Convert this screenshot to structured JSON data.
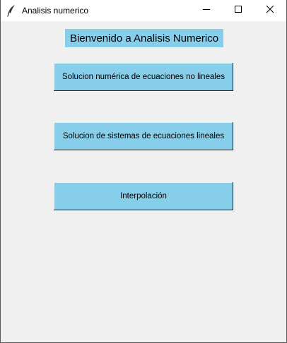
{
  "window": {
    "title": "Analisis numerico",
    "icon": "feather-icon"
  },
  "main": {
    "welcome_label": "Bienvenido a Analisis Numerico",
    "buttons": [
      {
        "label": "Solucion numérica de ecuaciones no lineales"
      },
      {
        "label": "Solucion de sistemas de ecuaciones lineales"
      },
      {
        "label": "Interpolación"
      }
    ]
  },
  "colors": {
    "accent": "#87ceeb",
    "background": "#f0f0f0",
    "titlebar": "#ffffff"
  }
}
